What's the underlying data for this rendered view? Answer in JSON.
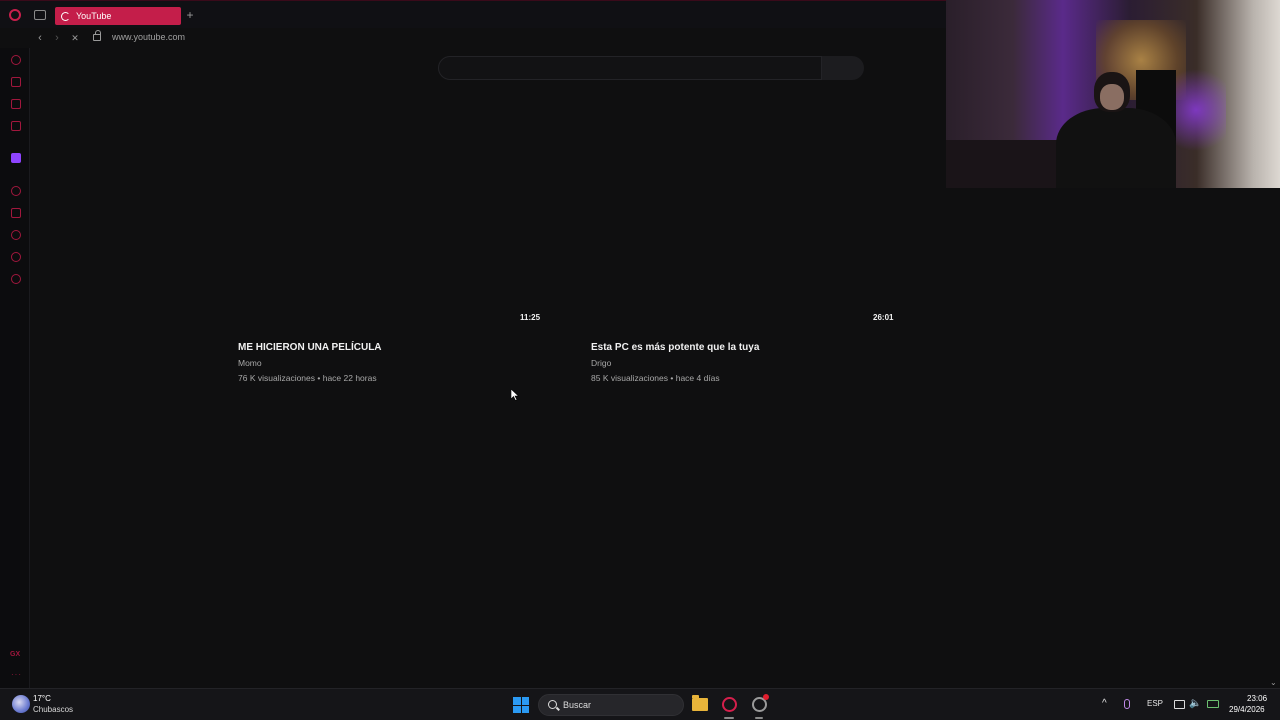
{
  "browser": {
    "tab_title": "YouTube",
    "new_tab_label": "+",
    "back_label": "‹",
    "forward_label": "›",
    "reload_label": "✕",
    "url": "www.youtube.com"
  },
  "sidebar": {
    "gx_label": "GX",
    "more_label": "···",
    "items": [
      "history-icon",
      "shop-icon",
      "messenger-icon",
      "news-icon",
      "twitch-icon",
      "player-icon",
      "pin-icon",
      "clock-icon",
      "chat-icon",
      "settings-icon"
    ]
  },
  "videos": [
    {
      "duration": "11:25",
      "title": "ME HICIERON UNA PELÍCULA",
      "channel": "Momo",
      "meta": "76 K visualizaciones • hace 22 horas"
    },
    {
      "duration": "26:01",
      "title": "Esta PC es más potente que la tuya",
      "channel": "Drigo",
      "meta": "85 K visualizaciones • hace 4 días"
    }
  ],
  "taskbar": {
    "weather_temp": "17°C",
    "weather_desc": "Chubascos",
    "search_placeholder": "Buscar",
    "language": "ESP",
    "chevron": "^",
    "volume": "🔈",
    "time": "23:06",
    "date": "29/4/2026"
  },
  "colors": {
    "accent": "#c41e4a",
    "background": "#0f0f10"
  }
}
